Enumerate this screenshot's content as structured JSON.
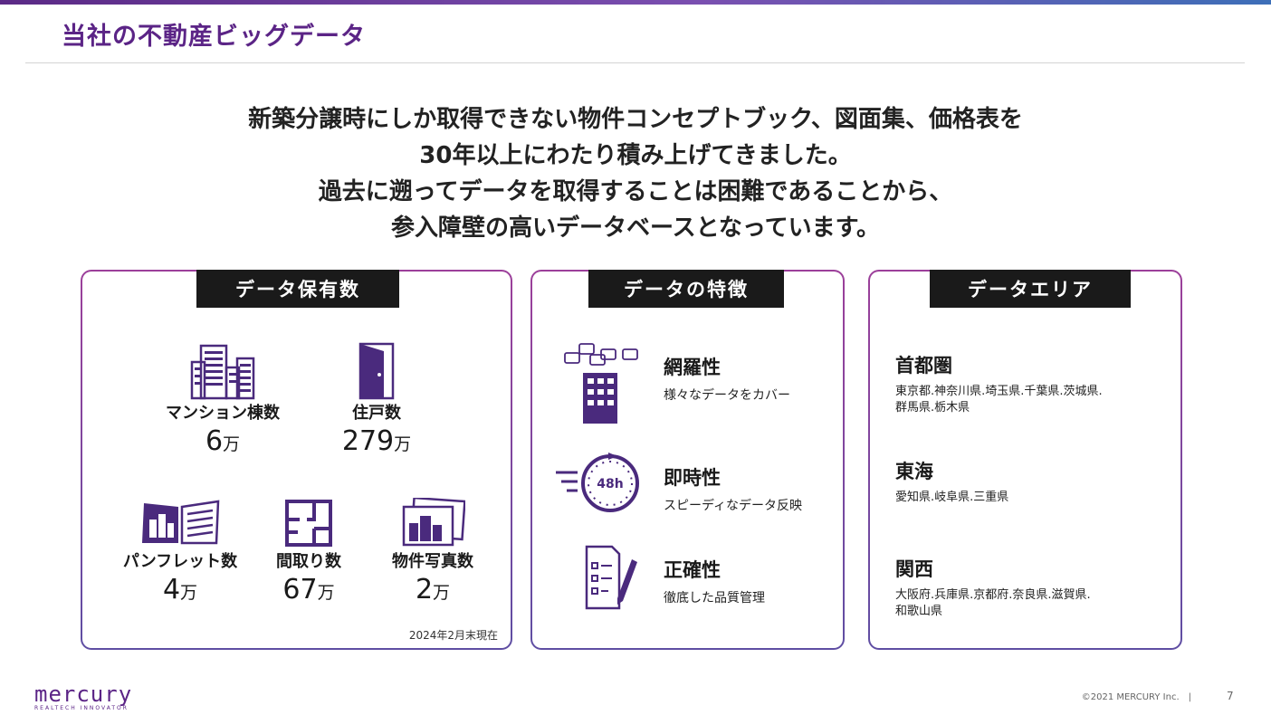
{
  "header": {
    "title": "当社の不動産ビッグデータ"
  },
  "lead": [
    "新築分譲時にしか取得できない物件コンセプトブック、図面集、価格表を",
    "30年以上にわたり積み上げてきました。",
    "過去に遡ってデータを取得することは困難であることから、",
    "参入障壁の高いデータベースとなっています。"
  ],
  "holdings": {
    "title": "データ保有数",
    "items": [
      {
        "label": "マンション棟数",
        "value": "6",
        "unit": "万",
        "icon": "buildings-icon"
      },
      {
        "label": "住戸数",
        "value": "279",
        "unit": "万",
        "icon": "door-icon"
      },
      {
        "label": "パンフレット数",
        "value": "4",
        "unit": "万",
        "icon": "brochure-icon"
      },
      {
        "label": "間取り数",
        "value": "67",
        "unit": "万",
        "icon": "floorplan-icon"
      },
      {
        "label": "物件写真数",
        "value": "2",
        "unit": "万",
        "icon": "photos-icon"
      }
    ],
    "as_of": "2024年2月末現在"
  },
  "features": {
    "title": "データの特徴",
    "items": [
      {
        "name": "網羅性",
        "desc": "様々なデータをカバー",
        "icon": "building-chat-icon"
      },
      {
        "name": "即時性",
        "desc": "スピーディなデータ反映",
        "icon": "clock-48h-icon",
        "icon_text": "48h"
      },
      {
        "name": "正確性",
        "desc": "徹底した品質管理",
        "icon": "checklist-icon"
      }
    ]
  },
  "areas": {
    "title": "データエリア",
    "items": [
      {
        "name": "首都圏",
        "list1": "東京都.神奈川県.埼玉県.千葉県.茨城県.",
        "list2": "群馬県.栃木県"
      },
      {
        "name": "東海",
        "list1": "愛知県.岐阜県.三重県",
        "list2": ""
      },
      {
        "name": "関西",
        "list1": "大阪府.兵庫県.京都府.奈良県.滋賀県.",
        "list2": "和歌山県"
      }
    ]
  },
  "footer": {
    "logo": "mercury",
    "tagline": "REALTECH INNOVATOR",
    "copyright": "©2021 MERCURY Inc.",
    "separator": "|",
    "page": "7"
  },
  "colors": {
    "accent": "#5b2486",
    "icon": "#4a2a7d",
    "panel_title_bg": "#1a1a1a"
  }
}
